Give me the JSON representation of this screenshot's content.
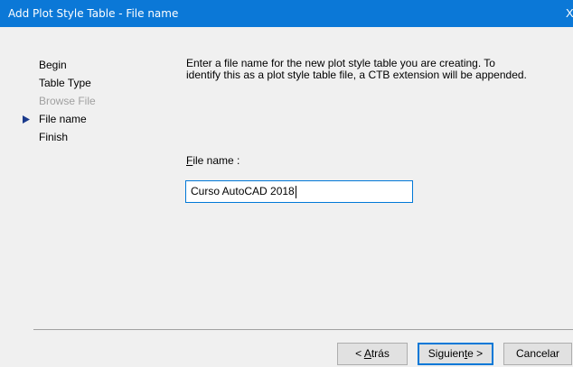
{
  "window": {
    "title": "Add Plot Style Table - File name",
    "close_glyph": "X",
    "close_icon": "close-icon"
  },
  "steps": [
    {
      "label": "Begin",
      "enabled": true,
      "current": false
    },
    {
      "label": "Table Type",
      "enabled": true,
      "current": false
    },
    {
      "label": "Browse File",
      "enabled": false,
      "current": false
    },
    {
      "label": "File name",
      "enabled": true,
      "current": true
    },
    {
      "label": "Finish",
      "enabled": true,
      "current": false
    }
  ],
  "current_step_icon": "triangle-right-icon",
  "main": {
    "description": "Enter a file name for the new plot style table you are creating. To identify this as a plot style table file, a CTB extension will be appended.",
    "file_name_label": {
      "mnemonic": "F",
      "rest": "ile name :"
    },
    "file_name_value": "Curso AutoCAD 2018"
  },
  "buttons": {
    "back": {
      "pre": "< ",
      "mnemonic": "A",
      "post": "trás"
    },
    "next": {
      "pre": "Siguien",
      "mnemonic": "t",
      "post": "e >"
    },
    "cancel": {
      "label": "Cancelar"
    }
  },
  "colors": {
    "title_bar": "#0b78d7",
    "accent": "#0078d7",
    "dialog_background": "#f0f0f0",
    "disabled_text": "#a0a0a0",
    "arrow": "#1a3a8c"
  }
}
